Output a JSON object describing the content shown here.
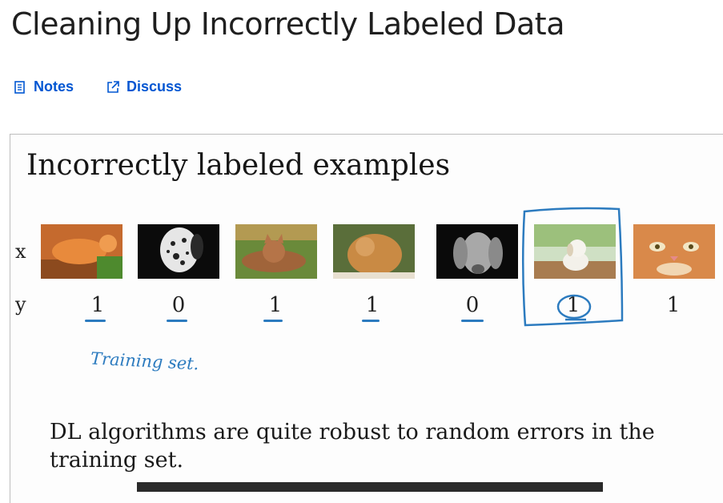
{
  "header": {
    "title": "Cleaning Up Incorrectly Labeled Data",
    "notes_label": "Notes",
    "discuss_label": "Discuss"
  },
  "slide": {
    "title": "Incorrectly labeled examples",
    "x_label": "x",
    "y_label": "y",
    "examples": [
      {
        "image": "cat-orange-icon",
        "label": "1"
      },
      {
        "image": "dog-dalmatian-icon",
        "label": "0"
      },
      {
        "image": "cat-lying-icon",
        "label": "1"
      },
      {
        "image": "cat-fluffy-icon",
        "label": "1"
      },
      {
        "image": "dog-weimaraner-icon",
        "label": "0"
      },
      {
        "image": "dog-puppy-icon",
        "label": "1"
      },
      {
        "image": "cat-closeup-icon",
        "label": "1"
      }
    ],
    "handwritten_note": "Training set.",
    "body": "DL algorithms are quite robust to random errors in the training set."
  },
  "colors": {
    "link": "#0056d2",
    "ink": "#2c7bbf"
  }
}
